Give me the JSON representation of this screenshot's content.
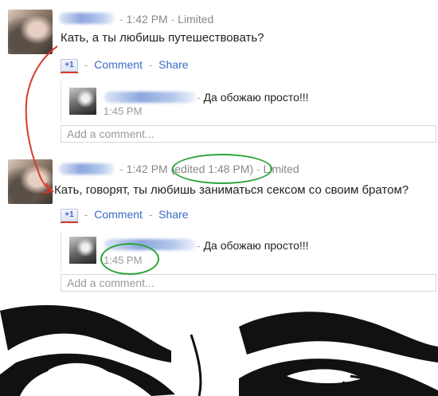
{
  "post1": {
    "time": "1:42 PM",
    "visibility": "Limited",
    "text": "Кать, а ты любишь путешествовать?",
    "plus_one": "+1",
    "comment_link": "Comment",
    "share_link": "Share",
    "reply": {
      "text": "Да обожаю просто!!!",
      "time": "1:45 PM"
    },
    "add_comment_placeholder": "Add a comment..."
  },
  "post2": {
    "time": "1:42 PM",
    "edited": "(edited 1:48 PM)",
    "visibility": "Limited",
    "text": "Кать, говорят, ты любишь заниматься сексом со своим братом?",
    "plus_one": "+1",
    "comment_link": "Comment",
    "share_link": "Share",
    "reply": {
      "text": "Да обожаю просто!!!",
      "time": "1:45 PM"
    },
    "add_comment_placeholder": "Add a comment..."
  },
  "annotations": {
    "circle_color": "#2aa43a",
    "arrow_color": "#d83a2d"
  },
  "colors": {
    "link": "#3a6bc4",
    "meta": "#888888"
  }
}
